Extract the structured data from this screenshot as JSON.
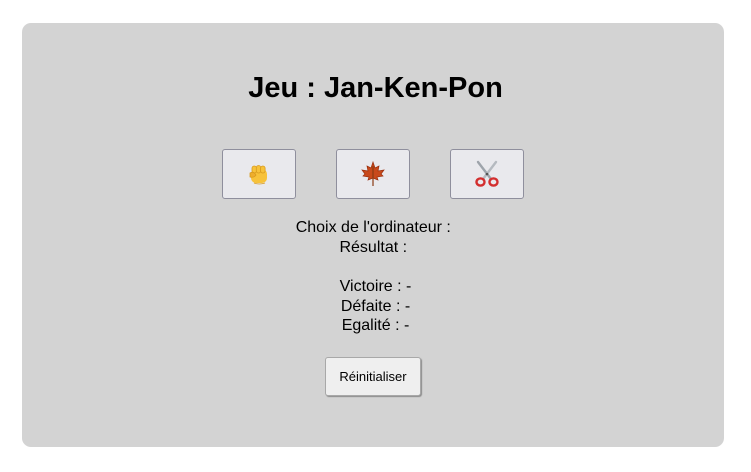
{
  "title": "Jeu : Jan-Ken-Pon",
  "choices": [
    {
      "id": "rock",
      "icon": "fist-icon"
    },
    {
      "id": "paper",
      "icon": "maple-leaf-icon"
    },
    {
      "id": "scissors",
      "icon": "scissors-icon"
    }
  ],
  "computer_choice": {
    "label": "Choix de l'ordinateur :",
    "value": ""
  },
  "result": {
    "label": "Résultat :",
    "value": ""
  },
  "stats": {
    "wins": {
      "label": "Victoire :",
      "value": "-"
    },
    "losses": {
      "label": "Défaite :",
      "value": "-"
    },
    "draws": {
      "label": "Egalité :",
      "value": "-"
    }
  },
  "reset_label": "Réinitialiser",
  "colors": {
    "panel": "#d3d3d3",
    "button_bg": "#e9e9ed",
    "button_border": "#8f8f9d"
  }
}
